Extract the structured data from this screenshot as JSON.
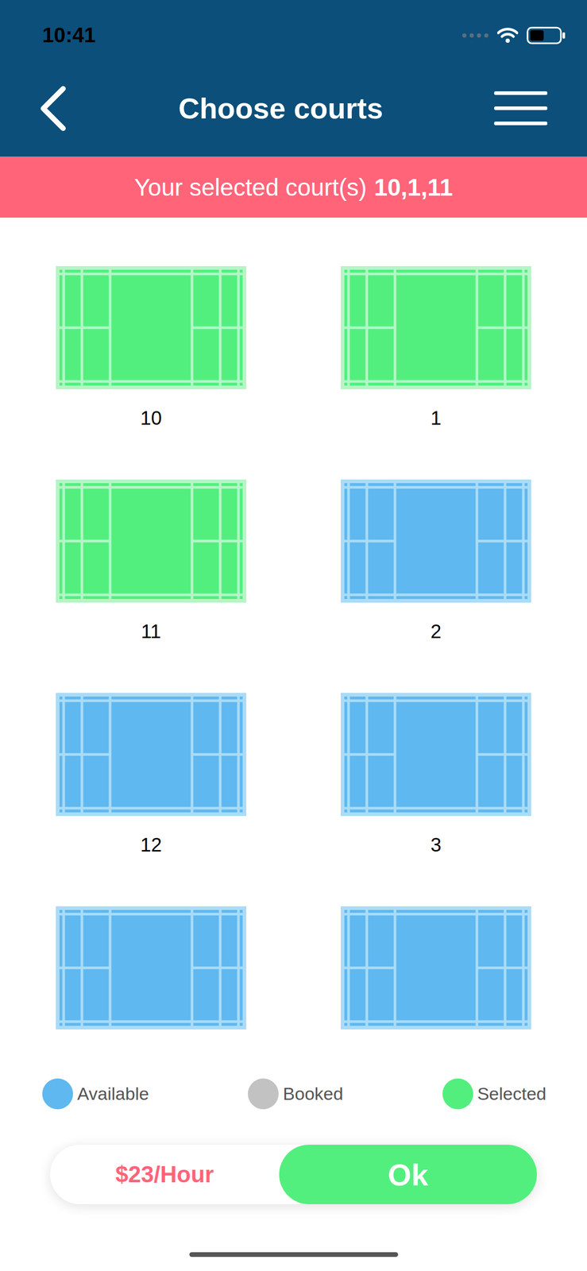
{
  "status_bar": {
    "time": "10:41"
  },
  "header": {
    "title": "Choose courts"
  },
  "banner": {
    "label": "Your selected court(s)",
    "value": "10,1,11"
  },
  "courts": [
    {
      "label": "10",
      "selected": true
    },
    {
      "label": "1",
      "selected": true
    },
    {
      "label": "11",
      "selected": true
    },
    {
      "label": "2",
      "selected": false
    },
    {
      "label": "12",
      "selected": false
    },
    {
      "label": "3",
      "selected": false
    },
    {
      "selected": false
    },
    {
      "selected": false
    }
  ],
  "legend": [
    {
      "label": "Available",
      "color": "#5fb8f0"
    },
    {
      "label": "Booked",
      "color": "#c2c2c2"
    },
    {
      "label": "Selected",
      "color": "#52ef7e"
    }
  ],
  "footer": {
    "price": "$23/Hour",
    "button": "Ok"
  }
}
